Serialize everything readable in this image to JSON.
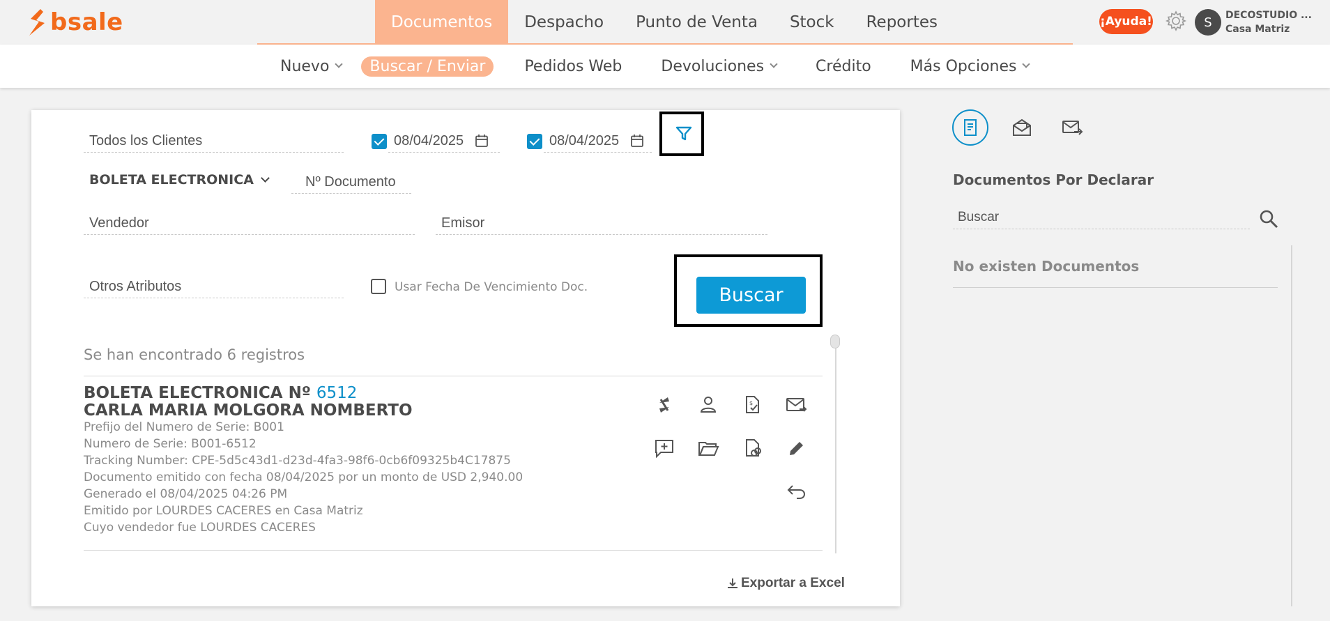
{
  "brand": {
    "name": "bsale",
    "color": "#f26a1b"
  },
  "main_nav": {
    "items": [
      {
        "label": "Documentos",
        "active": true
      },
      {
        "label": "Despacho",
        "active": false
      },
      {
        "label": "Punto de Venta",
        "active": false
      },
      {
        "label": "Stock",
        "active": false
      },
      {
        "label": "Reportes",
        "active": false
      }
    ]
  },
  "header": {
    "help_label": "¡Ayuda!",
    "avatar_initial": "S",
    "account_name": "DECOSTUDIO ...",
    "account_branch": "Casa Matriz"
  },
  "sub_nav": {
    "items": [
      {
        "label": "Nuevo",
        "dropdown": true,
        "active": false
      },
      {
        "label": "Buscar / Enviar",
        "dropdown": false,
        "active": true
      },
      {
        "label": "Pedidos Web",
        "dropdown": false,
        "active": false
      },
      {
        "label": "Devoluciones",
        "dropdown": true,
        "active": false
      },
      {
        "label": "Crédito",
        "dropdown": false,
        "active": false
      },
      {
        "label": "Más Opciones",
        "dropdown": true,
        "active": false
      }
    ]
  },
  "filters": {
    "client": "Todos los Clientes",
    "date_from": {
      "checked": true,
      "value": "08/04/2025"
    },
    "date_to": {
      "checked": true,
      "value": "08/04/2025"
    },
    "doc_type": "BOLETA ELECTRONICA",
    "doc_number_placeholder": "Nº Documento",
    "seller_placeholder": "Vendedor",
    "issuer_placeholder": "Emisor",
    "other_attrs_placeholder": "Otros Atributos",
    "use_due_date": {
      "checked": false,
      "label": "Usar Fecha De Vencimiento Doc."
    },
    "search_button": "Buscar"
  },
  "results": {
    "summary": "Se han encontrado 6 registros",
    "items": [
      {
        "doc_label": "BOLETA ELECTRONICA Nº",
        "doc_number": "6512",
        "client": "CARLA MARIA MOLGORA NOMBERTO",
        "lines": [
          "Prefijo del Numero de Serie: B001",
          "Numero de Serie: B001-6512",
          "Tracking Number: CPE-5d5c43d1-d23d-4fa3-98f6-0cb6f09325b4C17875",
          "Documento emitido con fecha 08/04/2025 por un monto de USD 2,940.00",
          "Generado el 08/04/2025 04:26 PM",
          "Emitido por LOURDES CACERES en Casa Matriz",
          "Cuyo vendedor fue LOURDES CACERES"
        ]
      }
    ],
    "export_label": "Exportar a Excel"
  },
  "right_panel": {
    "title": "Documentos Por Declarar",
    "search_placeholder": "Buscar",
    "empty_message": "No existen Documentos"
  }
}
